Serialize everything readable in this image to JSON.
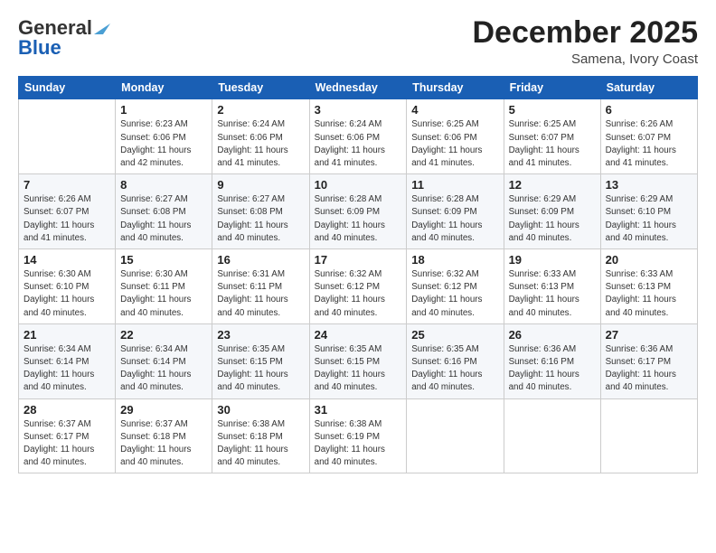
{
  "logo": {
    "line1": "General",
    "line2": "Blue"
  },
  "title": "December 2025",
  "location": "Samena, Ivory Coast",
  "days_header": [
    "Sunday",
    "Monday",
    "Tuesday",
    "Wednesday",
    "Thursday",
    "Friday",
    "Saturday"
  ],
  "weeks": [
    [
      {
        "num": "",
        "info": ""
      },
      {
        "num": "1",
        "info": "Sunrise: 6:23 AM\nSunset: 6:06 PM\nDaylight: 11 hours\nand 42 minutes."
      },
      {
        "num": "2",
        "info": "Sunrise: 6:24 AM\nSunset: 6:06 PM\nDaylight: 11 hours\nand 41 minutes."
      },
      {
        "num": "3",
        "info": "Sunrise: 6:24 AM\nSunset: 6:06 PM\nDaylight: 11 hours\nand 41 minutes."
      },
      {
        "num": "4",
        "info": "Sunrise: 6:25 AM\nSunset: 6:06 PM\nDaylight: 11 hours\nand 41 minutes."
      },
      {
        "num": "5",
        "info": "Sunrise: 6:25 AM\nSunset: 6:07 PM\nDaylight: 11 hours\nand 41 minutes."
      },
      {
        "num": "6",
        "info": "Sunrise: 6:26 AM\nSunset: 6:07 PM\nDaylight: 11 hours\nand 41 minutes."
      }
    ],
    [
      {
        "num": "7",
        "info": "Sunrise: 6:26 AM\nSunset: 6:07 PM\nDaylight: 11 hours\nand 41 minutes."
      },
      {
        "num": "8",
        "info": "Sunrise: 6:27 AM\nSunset: 6:08 PM\nDaylight: 11 hours\nand 40 minutes."
      },
      {
        "num": "9",
        "info": "Sunrise: 6:27 AM\nSunset: 6:08 PM\nDaylight: 11 hours\nand 40 minutes."
      },
      {
        "num": "10",
        "info": "Sunrise: 6:28 AM\nSunset: 6:09 PM\nDaylight: 11 hours\nand 40 minutes."
      },
      {
        "num": "11",
        "info": "Sunrise: 6:28 AM\nSunset: 6:09 PM\nDaylight: 11 hours\nand 40 minutes."
      },
      {
        "num": "12",
        "info": "Sunrise: 6:29 AM\nSunset: 6:09 PM\nDaylight: 11 hours\nand 40 minutes."
      },
      {
        "num": "13",
        "info": "Sunrise: 6:29 AM\nSunset: 6:10 PM\nDaylight: 11 hours\nand 40 minutes."
      }
    ],
    [
      {
        "num": "14",
        "info": "Sunrise: 6:30 AM\nSunset: 6:10 PM\nDaylight: 11 hours\nand 40 minutes."
      },
      {
        "num": "15",
        "info": "Sunrise: 6:30 AM\nSunset: 6:11 PM\nDaylight: 11 hours\nand 40 minutes."
      },
      {
        "num": "16",
        "info": "Sunrise: 6:31 AM\nSunset: 6:11 PM\nDaylight: 11 hours\nand 40 minutes."
      },
      {
        "num": "17",
        "info": "Sunrise: 6:32 AM\nSunset: 6:12 PM\nDaylight: 11 hours\nand 40 minutes."
      },
      {
        "num": "18",
        "info": "Sunrise: 6:32 AM\nSunset: 6:12 PM\nDaylight: 11 hours\nand 40 minutes."
      },
      {
        "num": "19",
        "info": "Sunrise: 6:33 AM\nSunset: 6:13 PM\nDaylight: 11 hours\nand 40 minutes."
      },
      {
        "num": "20",
        "info": "Sunrise: 6:33 AM\nSunset: 6:13 PM\nDaylight: 11 hours\nand 40 minutes."
      }
    ],
    [
      {
        "num": "21",
        "info": "Sunrise: 6:34 AM\nSunset: 6:14 PM\nDaylight: 11 hours\nand 40 minutes."
      },
      {
        "num": "22",
        "info": "Sunrise: 6:34 AM\nSunset: 6:14 PM\nDaylight: 11 hours\nand 40 minutes."
      },
      {
        "num": "23",
        "info": "Sunrise: 6:35 AM\nSunset: 6:15 PM\nDaylight: 11 hours\nand 40 minutes."
      },
      {
        "num": "24",
        "info": "Sunrise: 6:35 AM\nSunset: 6:15 PM\nDaylight: 11 hours\nand 40 minutes."
      },
      {
        "num": "25",
        "info": "Sunrise: 6:35 AM\nSunset: 6:16 PM\nDaylight: 11 hours\nand 40 minutes."
      },
      {
        "num": "26",
        "info": "Sunrise: 6:36 AM\nSunset: 6:16 PM\nDaylight: 11 hours\nand 40 minutes."
      },
      {
        "num": "27",
        "info": "Sunrise: 6:36 AM\nSunset: 6:17 PM\nDaylight: 11 hours\nand 40 minutes."
      }
    ],
    [
      {
        "num": "28",
        "info": "Sunrise: 6:37 AM\nSunset: 6:17 PM\nDaylight: 11 hours\nand 40 minutes."
      },
      {
        "num": "29",
        "info": "Sunrise: 6:37 AM\nSunset: 6:18 PM\nDaylight: 11 hours\nand 40 minutes."
      },
      {
        "num": "30",
        "info": "Sunrise: 6:38 AM\nSunset: 6:18 PM\nDaylight: 11 hours\nand 40 minutes."
      },
      {
        "num": "31",
        "info": "Sunrise: 6:38 AM\nSunset: 6:19 PM\nDaylight: 11 hours\nand 40 minutes."
      },
      {
        "num": "",
        "info": ""
      },
      {
        "num": "",
        "info": ""
      },
      {
        "num": "",
        "info": ""
      }
    ]
  ]
}
